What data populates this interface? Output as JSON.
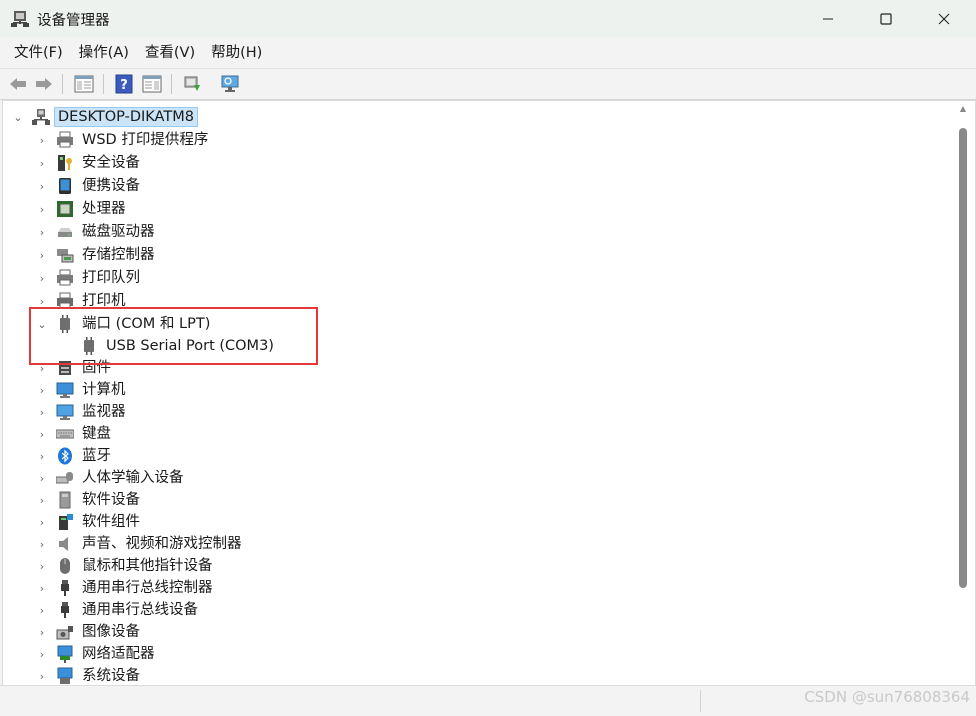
{
  "window": {
    "title": "设备管理器"
  },
  "menu": [
    "文件(F)",
    "操作(A)",
    "查看(V)",
    "帮助(H)"
  ],
  "tree": {
    "root": "DESKTOP-DIKATM8",
    "items": [
      {
        "label": "WSD 打印提供程序",
        "icon": "printer-icon"
      },
      {
        "label": "安全设备",
        "icon": "security-key-icon"
      },
      {
        "label": "便携设备",
        "icon": "portable-device-icon"
      },
      {
        "label": "处理器",
        "icon": "processor-icon"
      },
      {
        "label": "磁盘驱动器",
        "icon": "disk-drive-icon"
      },
      {
        "label": "存储控制器",
        "icon": "storage-controller-icon"
      },
      {
        "label": "打印队列",
        "icon": "print-queue-icon"
      },
      {
        "label": "打印机",
        "icon": "printer-icon"
      },
      {
        "label": "端口 (COM 和 LPT)",
        "icon": "port-icon",
        "expanded": true
      },
      {
        "label": "USB Serial Port (COM3)",
        "icon": "port-icon",
        "child": true
      },
      {
        "label": "固件",
        "icon": "firmware-icon"
      },
      {
        "label": "计算机",
        "icon": "computer-icon"
      },
      {
        "label": "监视器",
        "icon": "monitor-icon"
      },
      {
        "label": "键盘",
        "icon": "keyboard-icon"
      },
      {
        "label": "蓝牙",
        "icon": "bluetooth-icon"
      },
      {
        "label": "人体学输入设备",
        "icon": "hid-icon"
      },
      {
        "label": "软件设备",
        "icon": "software-device-icon"
      },
      {
        "label": "软件组件",
        "icon": "software-component-icon"
      },
      {
        "label": "声音、视频和游戏控制器",
        "icon": "speaker-icon"
      },
      {
        "label": "鼠标和其他指针设备",
        "icon": "mouse-icon"
      },
      {
        "label": "通用串行总线控制器",
        "icon": "usb-icon"
      },
      {
        "label": "通用串行总线设备",
        "icon": "usb-icon"
      },
      {
        "label": "图像设备",
        "icon": "camera-icon"
      },
      {
        "label": "网络适配器",
        "icon": "network-adapter-icon"
      },
      {
        "label": "系统设备",
        "icon": "system-device-icon"
      }
    ]
  },
  "watermark": "CSDN @sun76808364",
  "colors": {
    "highlight_box": "#e53935",
    "root_selection": "#cce4f7"
  }
}
